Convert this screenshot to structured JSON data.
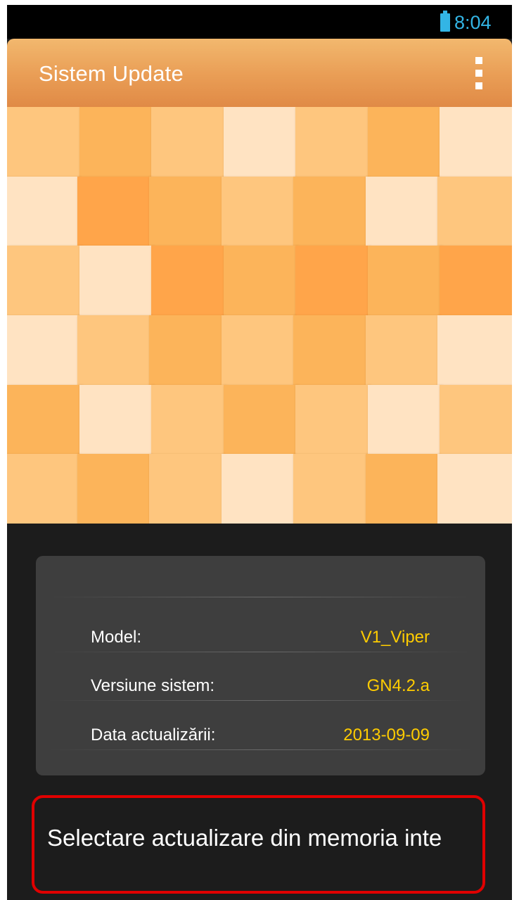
{
  "status_bar": {
    "time": "8:04",
    "battery_icon": "battery-icon",
    "accent_color": "#33b5e5"
  },
  "action_bar": {
    "title": "Sistem Update",
    "menu_icon": "overflow-menu-icon",
    "color": "#e99d55"
  },
  "banner": {
    "description_icon": "mosaic-banner",
    "palette": [
      "#fcb45a",
      "#fec67e",
      "#ffe3c2",
      "#ffa54a",
      "#fbb557"
    ]
  },
  "info": {
    "rows": [
      {
        "label": "Model:",
        "value": "V1_Viper"
      },
      {
        "label": "Versiune sistem:",
        "value": "GN4.2.a"
      },
      {
        "label": "Data actualizării:",
        "value": "2013-09-09"
      }
    ],
    "value_color": "#ffcc00"
  },
  "actions": {
    "select_update_label": "Selectare actualizare din memoria inte"
  }
}
